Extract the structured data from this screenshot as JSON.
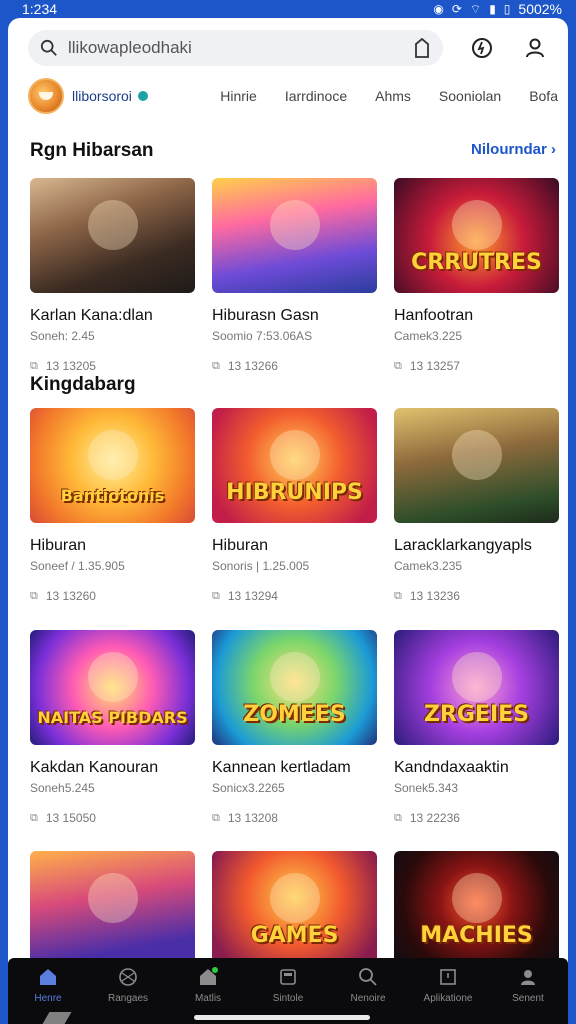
{
  "status": {
    "time": "1:234",
    "battery": "5002%"
  },
  "header": {
    "search_value": "llikowapleodhaki"
  },
  "app": {
    "name": "lliborsoroi",
    "nav_links": [
      "Hinrie",
      "Iarrdinoce",
      "Ahms",
      "Sooniolan",
      "Bofa"
    ]
  },
  "sections": [
    {
      "title": "Rgn Hibarsan",
      "see_all": "Nilourndar"
    },
    {
      "title": "Kingdabarg"
    }
  ],
  "cards": [
    {
      "title": "Karlan Kana:dlan",
      "sub": "Soneh: 2.45",
      "stat": "13 13205",
      "theme": "street",
      "tag": ""
    },
    {
      "title": "Hiburasn Gasn",
      "sub": "Soomio 7:53.06AS",
      "stat": "13 13266",
      "theme": "heroes",
      "tag": ""
    },
    {
      "title": "Hanfootran",
      "sub": "Camek3.225",
      "stat": "13 13257",
      "theme": "badge",
      "tag": "CRRUTRES"
    },
    {
      "title": "Hiburan",
      "sub": "Soneef / 1.35.905",
      "stat": "13 13260",
      "theme": "bear",
      "tag": "Bantiotonis"
    },
    {
      "title": "Hiburan",
      "sub": "Sonoris | 1.25.005",
      "stat": "13 13294",
      "theme": "bear2",
      "tag": "HIBRUNIPS"
    },
    {
      "title": "Laracklarkangyapls",
      "sub": "Camek3.235",
      "stat": "13 13236",
      "theme": "adventure",
      "tag": ""
    },
    {
      "title": "Kakdan Kanouran",
      "sub": "Soneh5.245",
      "stat": "13 15050",
      "theme": "neon",
      "tag": "NAITAS PIBDARS"
    },
    {
      "title": "Kannean kertladam",
      "sub": "Sonicx3.2265",
      "stat": "13 13208",
      "theme": "zomees",
      "tag": "ZOMEES"
    },
    {
      "title": "Kandndaxaaktin",
      "sub": "Sonek5.343",
      "stat": "13 22236",
      "theme": "mouse",
      "tag": "ZRGEIES"
    },
    {
      "title": "",
      "sub": "",
      "stat": "",
      "theme": "crew",
      "tag": ""
    },
    {
      "title": "",
      "sub": "",
      "stat": "",
      "theme": "games",
      "tag": "GAMES"
    },
    {
      "title": "",
      "sub": "",
      "stat": "",
      "theme": "machine",
      "tag": "MACHIES"
    }
  ],
  "bottom_nav": [
    {
      "label": "Henre",
      "icon": "home-icon",
      "active": true
    },
    {
      "label": "Rangaes",
      "icon": "ball-icon"
    },
    {
      "label": "Matlis",
      "icon": "store-icon"
    },
    {
      "label": "Sintole",
      "icon": "folder-icon"
    },
    {
      "label": "Nenoire",
      "icon": "search-icon"
    },
    {
      "label": "Aplikatione",
      "icon": "apps-icon"
    },
    {
      "label": "Senent",
      "icon": "person-icon"
    }
  ]
}
